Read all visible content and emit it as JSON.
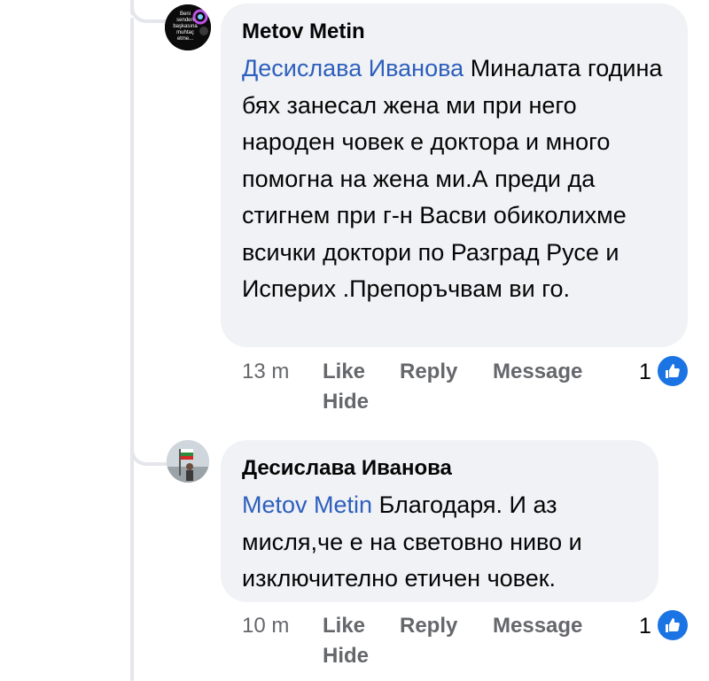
{
  "comments": [
    {
      "author": "Metov Metin",
      "avatar_text": [
        "Beni",
        "senden",
        "başkasına",
        "muhtaç",
        "etme..."
      ],
      "mention": "Десислава Иванова",
      "body": "Миналата година бях занесал жена ми при него народен човек е доктора и много помогна на жена ми.А преди да стигнем при г-н Васви обиколихме всички доктори по Разград Русе и Исперих .Препоръчвам ви го.",
      "time": "13 m",
      "like_label": "Like",
      "reply_label": "Reply",
      "message_label": "Message",
      "hide_label": "Hide",
      "reaction_count": "1"
    },
    {
      "author": "Десислава Иванова",
      "mention": "Metov Metin",
      "body": "Благодаря. И аз мисля,че е на световно ниво и изключително етичен човек.",
      "time": "10 m",
      "like_label": "Like",
      "reply_label": "Reply",
      "message_label": "Message",
      "hide_label": "Hide",
      "reaction_count": "1"
    }
  ],
  "colors": {
    "bubble": "#f0f2f5",
    "mention": "#2d5fbd",
    "meta": "#65676b",
    "like_badge": "#1b74e4"
  },
  "icons": {
    "reaction": "thumbs-up-icon"
  }
}
